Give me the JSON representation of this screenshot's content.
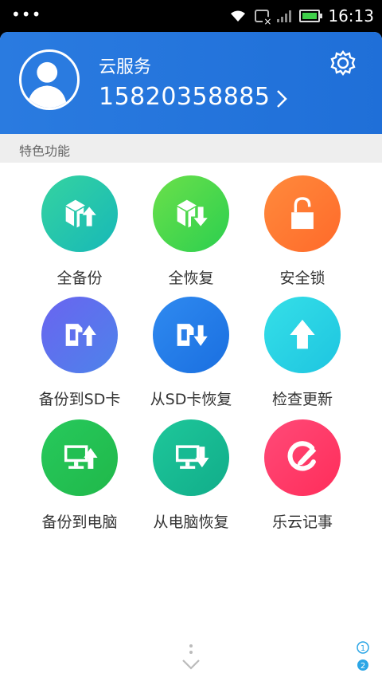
{
  "status_bar": {
    "time": "16:13"
  },
  "header": {
    "title": "云服务",
    "account": "15820358885"
  },
  "section": {
    "title": "特色功能"
  },
  "features": [
    {
      "label": "全备份",
      "icon": "box-upload-icon",
      "color_from": "#35d3a0",
      "color_to": "#17b8b8"
    },
    {
      "label": "全恢复",
      "icon": "box-download-icon",
      "color_from": "#6be04a",
      "color_to": "#2ccf4f"
    },
    {
      "label": "安全锁",
      "icon": "lock-icon",
      "color_from": "#ff8a3c",
      "color_to": "#ff6a2a"
    },
    {
      "label": "备份到SD卡",
      "icon": "sdcard-upload-icon",
      "color_from": "#6a64f0",
      "color_to": "#4d83ea"
    },
    {
      "label": "从SD卡恢复",
      "icon": "sdcard-download-icon",
      "color_from": "#2f8af0",
      "color_to": "#1a6fe0"
    },
    {
      "label": "检查更新",
      "icon": "up-arrow-icon",
      "color_from": "#35dfe8",
      "color_to": "#1ec5e0"
    },
    {
      "label": "备份到电脑",
      "icon": "monitor-upload-icon",
      "color_from": "#27c95c",
      "color_to": "#20b84a"
    },
    {
      "label": "从电脑恢复",
      "icon": "monitor-download-icon",
      "color_from": "#1ec79a",
      "color_to": "#11ad8a"
    },
    {
      "label": "乐云记事",
      "icon": "note-pen-icon",
      "color_from": "#ff4a78",
      "color_to": "#ff2d5a"
    }
  ],
  "pager": {
    "page_1": "1",
    "page_2": "2"
  }
}
